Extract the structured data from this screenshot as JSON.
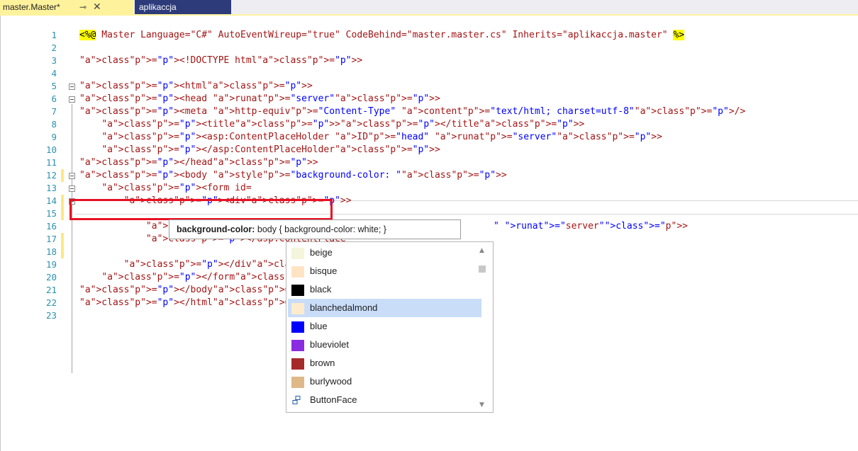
{
  "tabs": [
    {
      "label": "master.Master*",
      "pin_icon": "pin-icon",
      "close_icon": "close-icon",
      "active": true
    },
    {
      "label": "aplikaccja",
      "active": false
    }
  ],
  "lines": [
    {
      "num": "1"
    },
    {
      "num": "2"
    },
    {
      "num": "3"
    },
    {
      "num": "4"
    },
    {
      "num": "5"
    },
    {
      "num": "6"
    },
    {
      "num": "7"
    },
    {
      "num": "8"
    },
    {
      "num": "9"
    },
    {
      "num": "10"
    },
    {
      "num": "11"
    },
    {
      "num": "12"
    },
    {
      "num": "13"
    },
    {
      "num": "14"
    },
    {
      "num": "15"
    },
    {
      "num": "16"
    },
    {
      "num": "17"
    },
    {
      "num": "18"
    },
    {
      "num": "19"
    },
    {
      "num": "20"
    },
    {
      "num": "21"
    },
    {
      "num": "22"
    },
    {
      "num": "23"
    }
  ],
  "code": {
    "l1_open": "<%@",
    "l1_mid": " Master Language=\"C#\" AutoEventWireup=\"true\" CodeBehind=\"master.master.cs\" Inherits=\"aplikaccja.master\" ",
    "l1_close": "%>",
    "l3": "<!DOCTYPE html>",
    "l5": "<html>",
    "l6": "<head runat=\"server\">",
    "l7": "<meta http-equiv=\"Content-Type\" content=\"text/html; charset=utf-8\"/>",
    "l8": "    <title></title>",
    "l9": "    <asp:ContentPlaceHolder ID=\"head\" runat=\"server\">",
    "l10": "    </asp:ContentPlaceHolder>",
    "l11": "</head>",
    "l12": "<body style=\"background-color: \">",
    "l13": "    <form id=",
    "l14": "        <div>",
    "l16": "            <asp:ContentPlaceH",
    "l16_tail": "\" runat=\"server\">",
    "l17": "            </asp:ContentPlace",
    "l19": "        </div>",
    "l20": "    </form>",
    "l21": "</body>",
    "l22": "</html>"
  },
  "tooltip": {
    "property": "background-color:",
    "description": " body { background-color: white; }"
  },
  "completion": {
    "items": [
      {
        "label": "beige",
        "color": "#f5f5dc"
      },
      {
        "label": "bisque",
        "color": "#ffe4c4"
      },
      {
        "label": "black",
        "color": "#000000"
      },
      {
        "label": "blanchedalmond",
        "color": "#ffebcd",
        "selected": true
      },
      {
        "label": "blue",
        "color": "#0000ff"
      },
      {
        "label": "blueviolet",
        "color": "#8a2be2"
      },
      {
        "label": "brown",
        "color": "#a52a2a"
      },
      {
        "label": "burlywood",
        "color": "#deb887"
      },
      {
        "label": "ButtonFace",
        "icon": "system-color-icon"
      }
    ]
  }
}
